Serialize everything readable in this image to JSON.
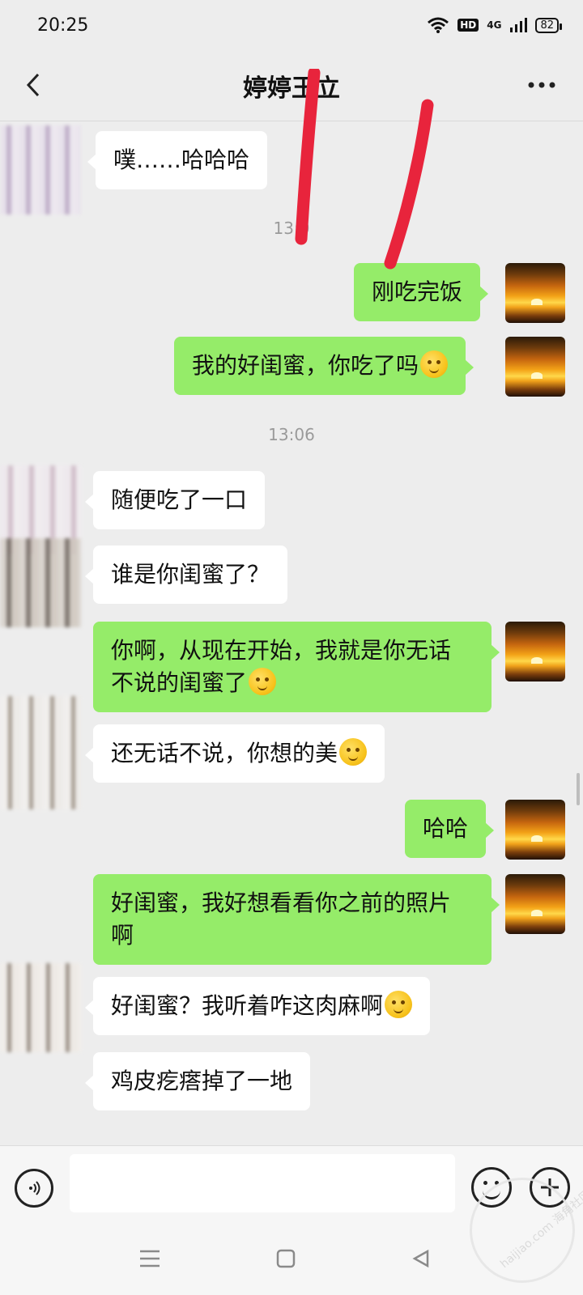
{
  "status_bar": {
    "time": "20:25",
    "hd": "HD",
    "network": "4G",
    "battery": "82"
  },
  "header": {
    "title": "婷婷玉立"
  },
  "messages": [
    {
      "side": "left",
      "text": "噗……哈哈哈"
    },
    {
      "timestamp": "13:0"
    },
    {
      "side": "right",
      "text": "刚吃完饭"
    },
    {
      "side": "right",
      "text": "我的好闺蜜，你吃了吗"
    },
    {
      "timestamp": "13:06"
    },
    {
      "side": "left",
      "text": "随便吃了一口"
    },
    {
      "side": "left",
      "text": "谁是你闺蜜了？"
    },
    {
      "side": "right",
      "text_line1": "你啊，从现在开始，我就是你无话",
      "text_line2": "不说的闺蜜了"
    },
    {
      "side": "left",
      "text": "还无话不说，你想的美"
    },
    {
      "side": "right",
      "text": "哈哈"
    },
    {
      "side": "right",
      "text_line1": "好闺蜜，我好想看看你之前的照片",
      "text_line2": "啊"
    },
    {
      "side": "left",
      "text": "好闺蜜？我听着咋这肉麻啊"
    },
    {
      "side": "left",
      "text": "鸡皮疙瘩掉了一地"
    }
  ],
  "watermark": "haijiao.com 海角社区",
  "colors": {
    "bubble_right": "#95ec69",
    "bubble_left": "#ffffff",
    "background": "#ededed",
    "annotation": "#e8243c"
  },
  "icons": {
    "back": "chevron-left-icon",
    "more": "more-dots-icon",
    "voice": "voice-icon",
    "emoji": "emoji-icon",
    "plus": "plus-icon"
  }
}
